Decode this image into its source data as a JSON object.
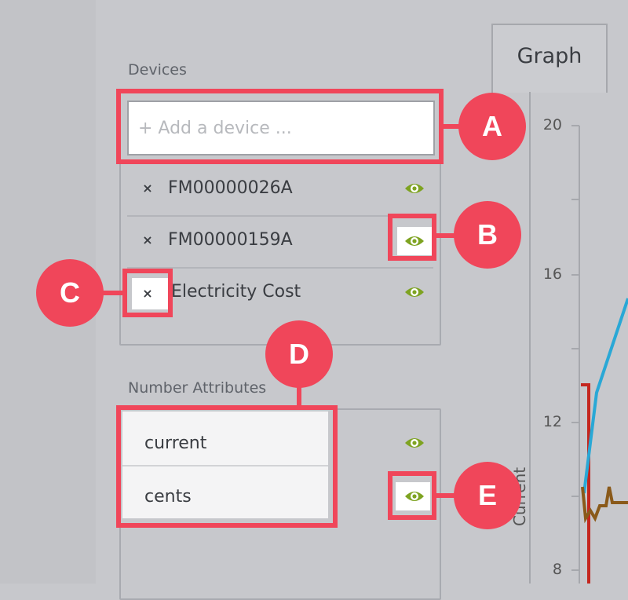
{
  "sidebar": {
    "devices_heading": "Devices",
    "add_device_placeholder": "+ Add a device ...",
    "devices": [
      {
        "name": "FM00000026A",
        "remove": "×"
      },
      {
        "name": "FM00000159A",
        "remove": "×"
      },
      {
        "name": "Electricity Cost",
        "remove": "×"
      }
    ],
    "attributes_heading": "Number Attributes",
    "attributes": [
      {
        "name": "current"
      },
      {
        "name": "cents"
      }
    ]
  },
  "graph": {
    "tab_label": "Graph",
    "y_ticks": [
      "20",
      "16",
      "12",
      "8"
    ],
    "y_axis_title": "Current"
  },
  "callouts": [
    "A",
    "B",
    "C",
    "D",
    "E"
  ],
  "colors": {
    "highlight": "#f0465a",
    "eye": "#7ea321",
    "series_red": "#c4261e",
    "series_blue": "#29a8d6",
    "series_brown": "#8a5a1a"
  }
}
